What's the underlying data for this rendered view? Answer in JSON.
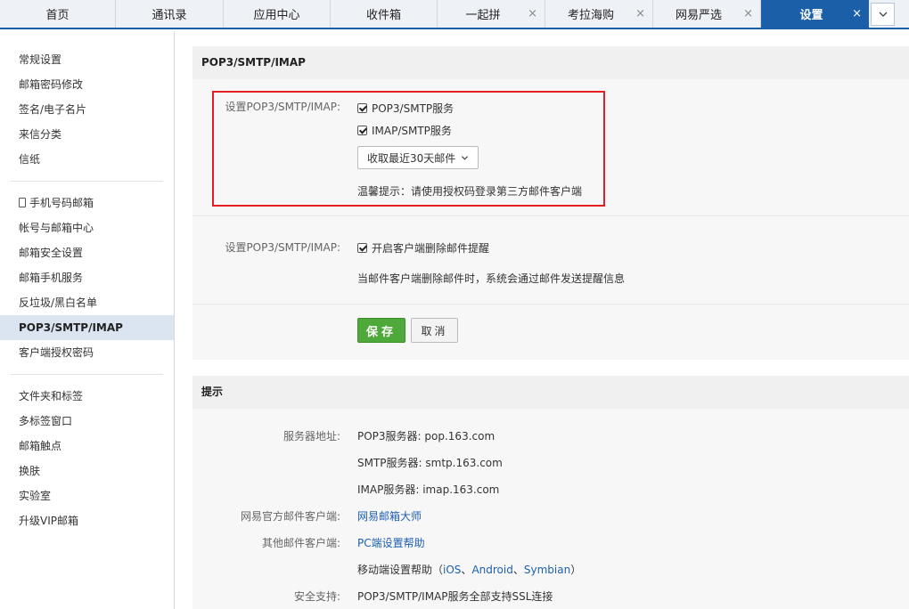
{
  "tabs": [
    {
      "label": "首页",
      "closable": false
    },
    {
      "label": "通讯录",
      "closable": false
    },
    {
      "label": "应用中心",
      "closable": false
    },
    {
      "label": "收件箱",
      "closable": false
    },
    {
      "label": "一起拼",
      "closable": true
    },
    {
      "label": "考拉海购",
      "closable": true
    },
    {
      "label": "网易严选",
      "closable": true
    },
    {
      "label": "设置",
      "closable": true,
      "active": true
    }
  ],
  "close_glyph": "×",
  "sidebar": {
    "groups": [
      [
        "常规设置",
        "邮箱密码修改",
        "签名/电子名片",
        "来信分类",
        "信纸"
      ],
      [
        "手机号码邮箱",
        "帐号与邮箱中心",
        "邮箱安全设置",
        "邮箱手机服务",
        "反垃圾/黑白名单",
        "POP3/SMTP/IMAP",
        "客户端授权密码"
      ],
      [
        "文件夹和标签",
        "多标签窗口",
        "邮箱触点",
        "换肤",
        "实验室",
        "升级VIP邮箱"
      ]
    ],
    "active_item": "POP3/SMTP/IMAP"
  },
  "settings_panel": {
    "title": "POP3/SMTP/IMAP",
    "row1_label": "设置POP3/SMTP/IMAP:",
    "pop3_smtp_label": "POP3/SMTP服务",
    "pop3_smtp_checked": true,
    "imap_smtp_label": "IMAP/SMTP服务",
    "imap_smtp_checked": true,
    "fetch_select": "收取最近30天邮件",
    "tip": "温馨提示：请使用授权码登录第三方邮件客户端",
    "row2_label": "设置POP3/SMTP/IMAP:",
    "delete_alert_label": "开启客户端删除邮件提醒",
    "delete_alert_checked": true,
    "delete_alert_desc": "当邮件客户端删除邮件时，系统会通过邮件发送提醒信息",
    "save_label": "保存",
    "cancel_label": "取消"
  },
  "tips_panel": {
    "title": "提示",
    "server_label": "服务器地址:",
    "pop3_server": "POP3服务器: pop.163.com",
    "smtp_server": "SMTP服务器: smtp.163.com",
    "imap_server": "IMAP服务器: imap.163.com",
    "official_client_label": "网易官方邮件客户端:",
    "official_client_link": "网易邮箱大师",
    "other_client_label": "其他邮件客户端:",
    "pc_help_link": "PC端设置帮助",
    "mobile_help_prefix": "移动端设置帮助（",
    "mobile_links": [
      "iOS",
      "Android",
      "Symbian"
    ],
    "mobile_sep": "、",
    "mobile_help_suffix": "）",
    "security_label": "安全支持:",
    "security_text": "POP3/SMTP/IMAP服务全部支持SSL连接"
  },
  "colors": {
    "accent": "#1a5fa8",
    "save": "#4ea93a",
    "highlight_box": "#e31e24",
    "link": "#1e5fb3"
  }
}
